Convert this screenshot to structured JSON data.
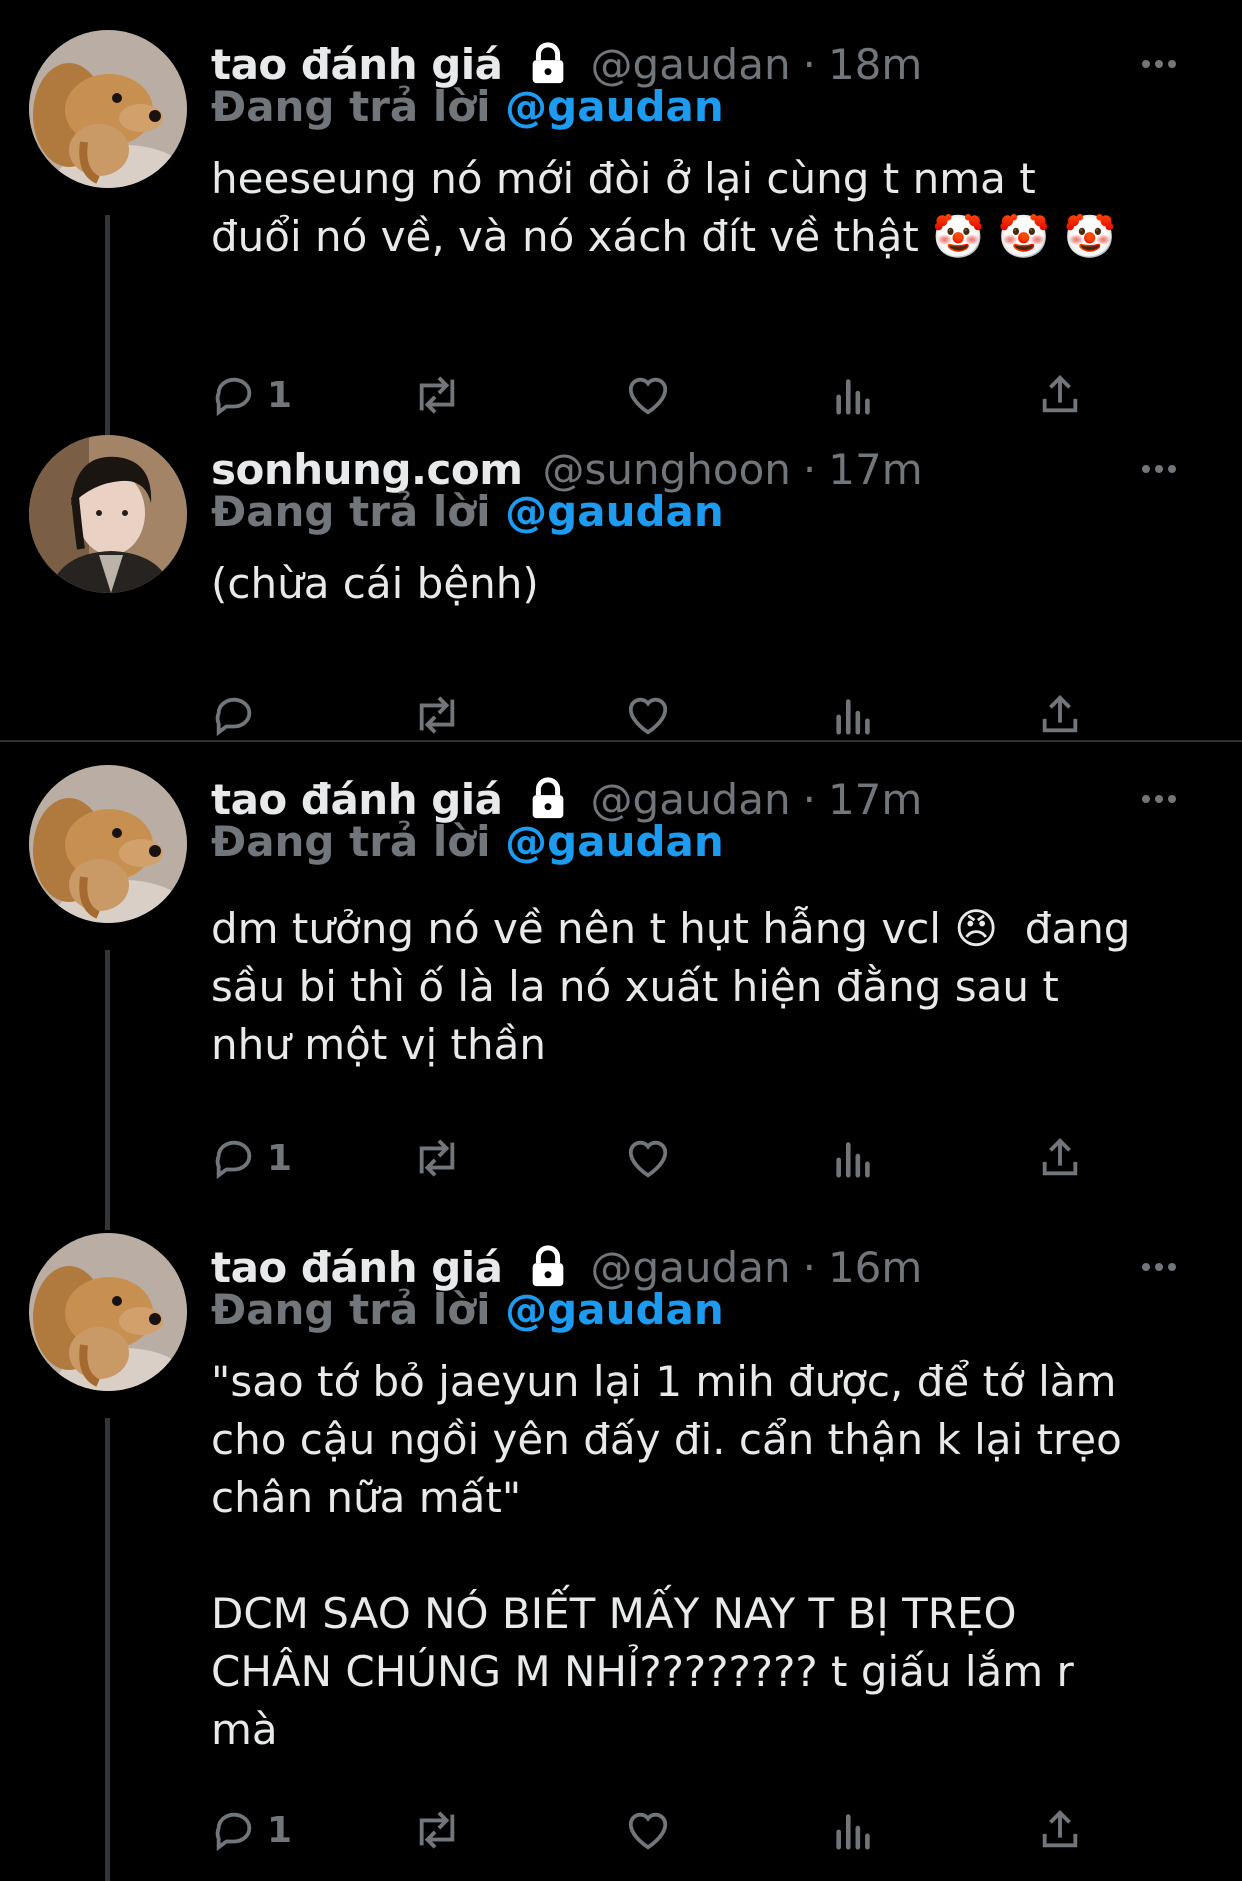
{
  "tweets": [
    {
      "name": "tao đánh giá",
      "handle": "@gaudan",
      "sep": "·",
      "time": "18m",
      "reply_prefix": "Đang trả lời",
      "reply_to": "@gaudan",
      "text": "heeseung nó mới đòi ở lại cùng t nma t\nđuổi nó về, và nó xách đít về thật 🤡 🤡 🤡",
      "reply_count": "1"
    },
    {
      "name": "sonhung.com",
      "handle": "@sunghoon",
      "sep": "·",
      "time": "17m",
      "reply_prefix": "Đang trả lời",
      "reply_to": "@gaudan",
      "text": "(chừa cái bệnh)",
      "reply_count": ""
    },
    {
      "name": "tao đánh giá",
      "handle": "@gaudan",
      "sep": "·",
      "time": "17m",
      "reply_prefix": "Đang trả lời",
      "reply_to": "@gaudan",
      "text": "dm tưởng nó về nên t hụt hẫng vcl 😠  đang\nsầu bi thì ố là la nó xuất hiện đằng sau t\nnhư một vị thần",
      "reply_count": "1"
    },
    {
      "name": "tao đánh giá",
      "handle": "@gaudan",
      "sep": "·",
      "time": "16m",
      "reply_prefix": "Đang trả lời",
      "reply_to": "@gaudan",
      "text": "\"sao tớ bỏ jaeyun lại 1 mih được, để tớ làm\ncho cậu ngồi yên đấy đi. cẩn thận k lại trẹo\nchân nữa mất\"\n\nDCM SAO NÓ BIẾT MẤY NAY T BỊ TRẸO\nCHÂN CHÚNG M NHỈ???????? t giấu lắm r\nmà",
      "reply_count": "1"
    }
  ],
  "icons": {
    "lock": "lock-icon",
    "more": "more-icon",
    "reply": "reply-icon",
    "retweet": "retweet-icon",
    "like": "like-icon",
    "views": "views-icon",
    "share": "share-icon"
  },
  "colors": {
    "background": "#000000",
    "text": "#e7e9ea",
    "secondary": "#71767b",
    "mention": "#1d9bf0",
    "divider": "#2f3336"
  }
}
